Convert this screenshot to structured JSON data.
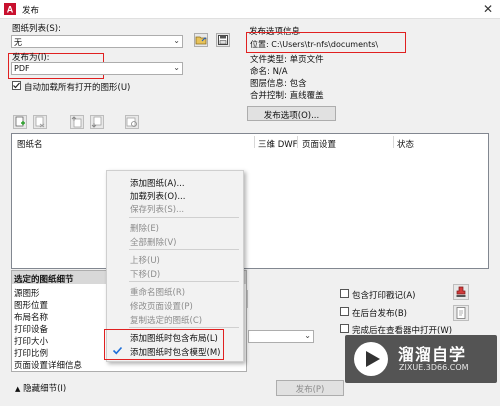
{
  "window": {
    "title": "发布",
    "close_glyph": "✕"
  },
  "sheet_list": {
    "label": "图纸列表(S):",
    "value": "无"
  },
  "publish_to": {
    "label": "发布为(I):",
    "value": "PDF"
  },
  "auto_load": {
    "label": "自动加载所有打开的图形(U)",
    "checked": true
  },
  "options": {
    "header": "发布选项信息",
    "location": "位置: C:\\Users\\tr-nfs\\documents\\",
    "file_type": "文件类型: 单页文件",
    "naming": "命名: N/A",
    "layer_info": "图层信息: 包含",
    "merge_control": "合并控制: 直线覆盖",
    "button": "发布选项(O)..."
  },
  "columns": {
    "sheet_name": "图纸名",
    "three_d_dwf": "三维 DWF",
    "page_setup": "页面设置",
    "status": "状态"
  },
  "context_menu": {
    "items": [
      {
        "label": "添加图纸(A)...",
        "enabled": true
      },
      {
        "label": "加载列表(O)...",
        "enabled": true
      },
      {
        "label": "保存列表(S)...",
        "enabled": false
      },
      {
        "label": "删除(E)",
        "enabled": false
      },
      {
        "label": "全部删除(V)",
        "enabled": false
      },
      {
        "label": "上移(U)",
        "enabled": false
      },
      {
        "label": "下移(D)",
        "enabled": false
      },
      {
        "label": "重命名图纸(R)",
        "enabled": false
      },
      {
        "label": "修改页面设置(P)",
        "enabled": false
      },
      {
        "label": "复制选定的图纸(C)",
        "enabled": false
      },
      {
        "label": "添加图纸时包含布局(L)",
        "enabled": true,
        "checked": false
      },
      {
        "label": "添加图纸时包含模型(M)",
        "enabled": true,
        "checked": true
      }
    ]
  },
  "details": {
    "header": "选定的图纸细节",
    "rows": [
      "源图形",
      "图形位置",
      "布局名称",
      "打印设备",
      "打印大小",
      "打印比例",
      "页面设置详细信息"
    ]
  },
  "right_options": {
    "include_stamp": "包含打印戳记(A)",
    "publish_background": "在后台发布(B)",
    "open_viewer": "完成后在查看器中打开(W)"
  },
  "footer": {
    "hide_details": "隐藏细节(I)",
    "publish_button": "发布(P)"
  },
  "watermark": {
    "brand_cn": "溜溜自学",
    "brand_en": "ZIXUE.3D66.COM"
  },
  "colors": {
    "highlight_red": "#e02020",
    "check_blue": "#1e6fd9",
    "watermark_bg": "#333333"
  }
}
